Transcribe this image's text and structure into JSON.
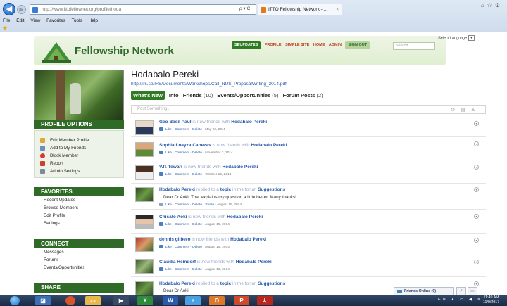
{
  "browser": {
    "url": "http://www.ittofellownet.org/profile/hoda",
    "address_controls": "ρ ▾ C",
    "tab_title": "ITTO Fellowship Network - ...",
    "menu": [
      "File",
      "Edit",
      "View",
      "Favorites",
      "Tools",
      "Help"
    ]
  },
  "site": {
    "logo_text": "Fellowship Network",
    "nav": {
      "updates": "SEUPDATES",
      "profile": "PROFILE",
      "simple_site": "SIMPLE SITE",
      "home": "HOME",
      "admin": "ADMIN",
      "sign_out": "SIGN OUT"
    },
    "search_placeholder": "Search",
    "language_label": "Select Language"
  },
  "sidebar": {
    "profile_options_title": "PROFILE OPTIONS",
    "profile_options": [
      "Edit Member Profile",
      "Add to My Friends",
      "Block Member",
      "Report",
      "Admin Settings"
    ],
    "favorites_title": "FAVORITES",
    "favorites": [
      "Recent Updates",
      "Browse Members",
      "Edit Profile",
      "Settings"
    ],
    "connect_title": "CONNECT",
    "connect": [
      "Messages",
      "Forums",
      "Events/Opportunities"
    ],
    "share_title": "SHARE"
  },
  "profile": {
    "name": "Hodabalo Pereki",
    "link": "http://ifs.se/IFS/Documents/Workshops/Call_NUS_ProposalWriting_2014.pdf",
    "tabs": {
      "whats_new": "What's New",
      "info": "Info",
      "friends": "Friends",
      "friends_count": "(10)",
      "events": "Events/Opportunities",
      "events_count": "(5)",
      "forum": "Forum Posts",
      "forum_count": "(2)"
    },
    "post_placeholder": "Post Something..."
  },
  "feed": [
    {
      "who": "Geo Basil Paul",
      "mid": " is now friends with ",
      "target": "Hodabalo Pereki",
      "actions": "Like · Comment · Delete ·",
      "date": "May 22, 2015"
    },
    {
      "who": "Sophia Loayza Cabezas",
      "mid": " is now friends with ",
      "target": "Hodabalo Pereki",
      "actions": "Like · Comment · Delete ·",
      "date": "November 2, 2014"
    },
    {
      "who": "V.P. Tewari",
      "mid": " is now friends with ",
      "target": "Hodabalo Pereki",
      "actions": "Like · Comment · Delete ·",
      "date": "October 15, 2014"
    },
    {
      "who": "Hodabalo Pereki",
      "mid": " replied to a ",
      "topic": "topic",
      "mid2": " in the forum ",
      "target": "Suggestions",
      "quote": "Dear Dr Aoki. That explains my question a little better.  Many thanks!",
      "actions": "Like · Comment · Delete · Share ·",
      "date": "August 19, 2014"
    },
    {
      "who": "Chisato Aoki",
      "mid": " is now friends with ",
      "target": "Hodabalo Pereki",
      "actions": "Like · Comment · Delete ·",
      "date": "August 19, 2014"
    },
    {
      "who": "dennis gilbero",
      "mid": " is now friends with ",
      "target": "Hodabalo Pereki",
      "actions": "Like · Comment · Delete ·",
      "date": "August 15, 2014"
    },
    {
      "who": "Claudia Heindorf",
      "mid": " is now friends with ",
      "target": "Hodabalo Pereki",
      "actions": "Like · Comment · Delete ·",
      "date": "August 13, 2014"
    },
    {
      "who": "Hodabalo Pereki",
      "mid": " replied to a ",
      "topic": "topic",
      "mid2": " in the forum ",
      "target": "Suggestions",
      "quote": "Dear Dr Aoki,"
    }
  ],
  "friends_online": "Friends Online (0)",
  "taskbar": {
    "tray": "EN ▲ ▭ ◀ ⇅",
    "time": "11:49 AM",
    "date": "11/9/2017"
  }
}
